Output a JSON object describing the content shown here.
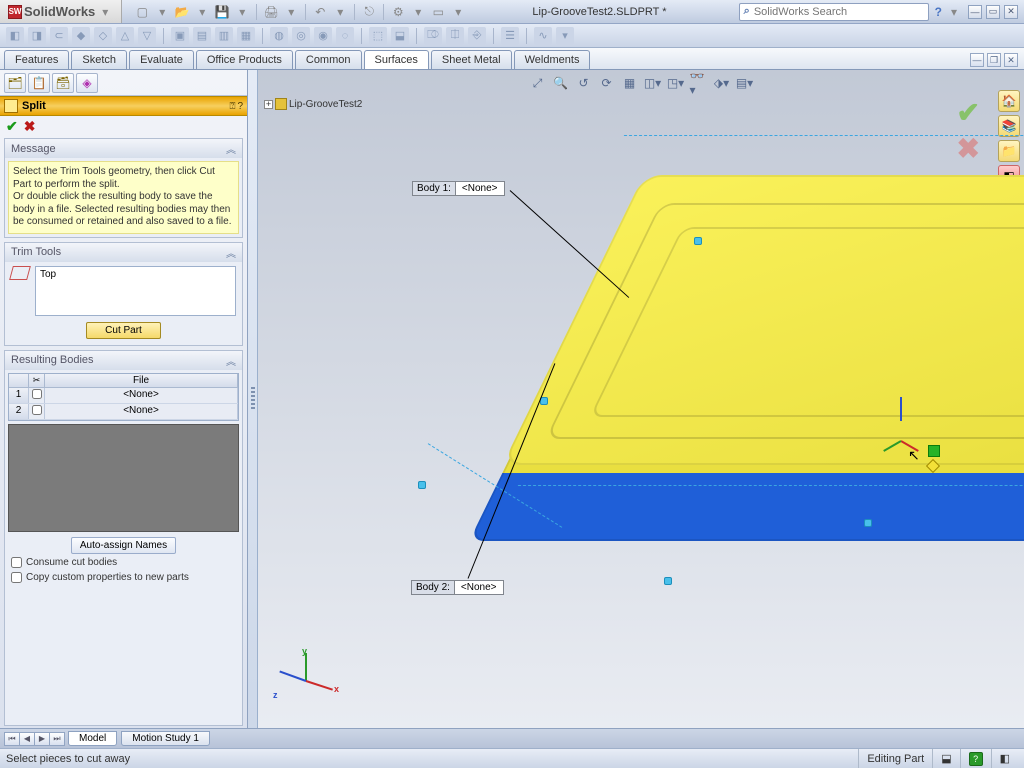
{
  "app": {
    "name_a": "Solid",
    "name_b": "Works",
    "doc_title": "Lip-GrooveTest2.SLDPRT *",
    "search_placeholder": "SolidWorks Search"
  },
  "tabs": {
    "t0": "Features",
    "t1": "Sketch",
    "t2": "Evaluate",
    "t3": "Office Products",
    "t4": "Common",
    "t5": "Surfaces",
    "t6": "Sheet Metal",
    "t7": "Weldments"
  },
  "tree": {
    "root": "Lip-GrooveTest2"
  },
  "feature": {
    "name": "Split"
  },
  "message": {
    "title": "Message",
    "body": "Select the Trim Tools geometry, then click Cut Part to perform the split.\nOr double click the resulting body to save the body in a file. Selected resulting bodies may then be consumed or retained and also saved to a file."
  },
  "trim": {
    "title": "Trim Tools",
    "items": "Top",
    "cut_btn": "Cut Part"
  },
  "bodies": {
    "title": "Resulting Bodies",
    "head_file": "File",
    "rows": [
      {
        "idx": "1",
        "file": "<None>"
      },
      {
        "idx": "2",
        "file": "<None>"
      }
    ],
    "auto_btn": "Auto-assign Names",
    "consume": "Consume cut bodies",
    "copyprops": "Copy custom properties to new parts"
  },
  "callouts": {
    "b1_lbl": "Body  1:",
    "b1_val": "<None>",
    "b2_lbl": "Body  2:",
    "b2_val": "<None>"
  },
  "bottom": {
    "model": "Model",
    "motion": "Motion Study 1"
  },
  "status": {
    "hint": "Select pieces to cut away",
    "mode": "Editing Part"
  },
  "triad": {
    "x": "x",
    "y": "y",
    "z": "z"
  }
}
